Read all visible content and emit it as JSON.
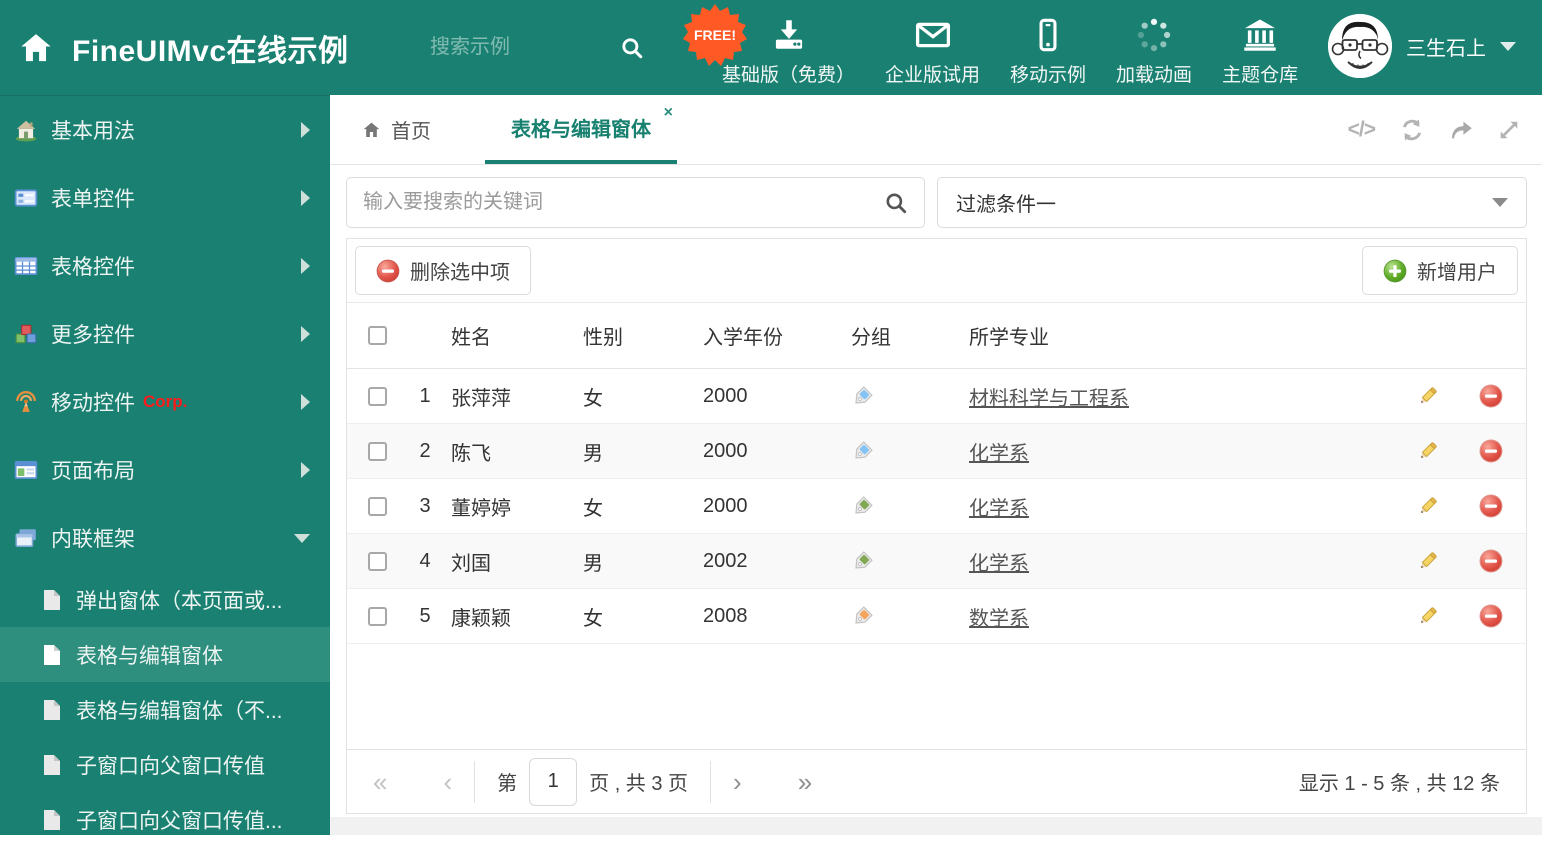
{
  "colors": {
    "accent": "#1a8172",
    "selected_item": "#2e8f7f",
    "free_badge": "#ff5a26",
    "corp_red": "#ff1a1a",
    "delete_red": "#dd4b3e",
    "add_green": "#54a51f"
  },
  "header": {
    "title": "FineUIMvc在线示例",
    "search_placeholder": "搜索示例",
    "free_badge": "FREE!",
    "nav": [
      {
        "label": "基础版（免费）"
      },
      {
        "label": "企业版试用"
      },
      {
        "label": "移动示例"
      },
      {
        "label": "加载动画"
      },
      {
        "label": "主题仓库"
      }
    ],
    "user_name": "三生石上"
  },
  "sidebar": {
    "items": [
      {
        "label": "基本用法"
      },
      {
        "label": "表单控件"
      },
      {
        "label": "表格控件"
      },
      {
        "label": "更多控件"
      },
      {
        "label": "移动控件",
        "badge": "Corp."
      },
      {
        "label": "页面布局"
      },
      {
        "label": "内联框架"
      }
    ],
    "subitems": [
      {
        "label": "弹出窗体（本页面或..."
      },
      {
        "label": "表格与编辑窗体"
      },
      {
        "label": "表格与编辑窗体（不..."
      },
      {
        "label": "子窗口向父窗口传值"
      },
      {
        "label": "子窗口向父窗口传值..."
      }
    ]
  },
  "tabs": {
    "home_label": "首页",
    "active_label": "表格与编辑窗体",
    "close_icon": "×"
  },
  "tab_tools": {
    "code_icon": "</>"
  },
  "filter_bar": {
    "search_placeholder": "输入要搜索的关键词",
    "filter_value": "过滤条件一"
  },
  "grid": {
    "delete_button": "删除选中项",
    "add_button": "新增用户",
    "columns": {
      "name": "姓名",
      "gender": "性别",
      "year": "入学年份",
      "group": "分组",
      "major": "所学专业"
    },
    "rows": [
      {
        "index": "1",
        "name": "张萍萍",
        "gender": "女",
        "year": "2000",
        "tag_color": "#85c3f5",
        "major": "材料科学与工程系"
      },
      {
        "index": "2",
        "name": "陈飞",
        "gender": "男",
        "year": "2000",
        "tag_color": "#85c3f5",
        "major": "化学系"
      },
      {
        "index": "3",
        "name": "董婷婷",
        "gender": "女",
        "year": "2000",
        "tag_color": "#82a854",
        "major": "化学系"
      },
      {
        "index": "4",
        "name": "刘国",
        "gender": "男",
        "year": "2002",
        "tag_color": "#82a854",
        "major": "化学系"
      },
      {
        "index": "5",
        "name": "康颖颖",
        "gender": "女",
        "year": "2008",
        "tag_color": "#f6a55e",
        "major": "数学系"
      }
    ]
  },
  "pagination": {
    "first_icon": "«",
    "prev_icon": "‹",
    "next_icon": "›",
    "last_icon": "»",
    "page_prefix": "第",
    "page_value": "1",
    "page_suffix": "页 , 共 3 页",
    "summary": "显示 1 - 5 条 , 共 12 条"
  }
}
